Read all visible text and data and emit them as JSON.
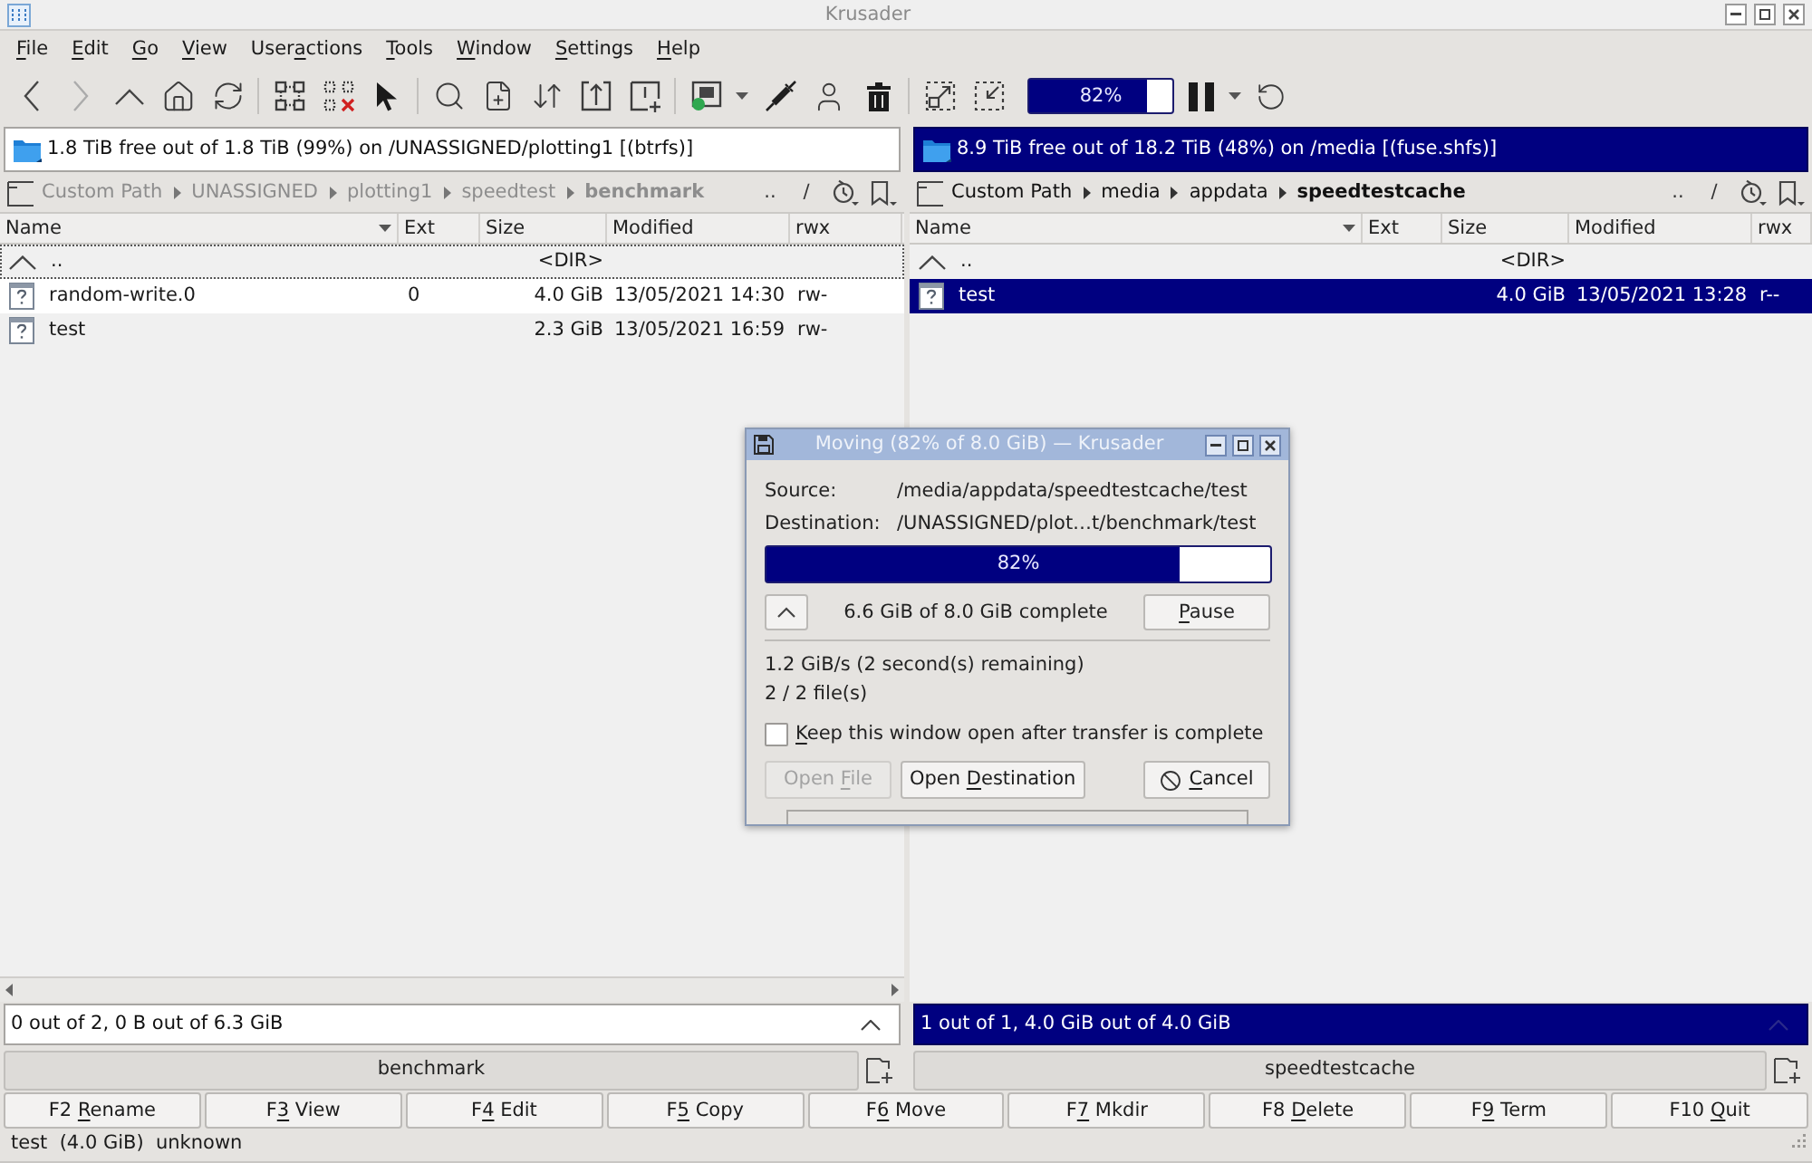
{
  "window": {
    "title": "Krusader"
  },
  "menu": [
    {
      "key": "F",
      "post": "ile"
    },
    {
      "key": "E",
      "post": "dit"
    },
    {
      "key": "G",
      "post": "o"
    },
    {
      "key": "V",
      "post": "iew"
    },
    {
      "pre": "User",
      "key": "a",
      "post": "ctions"
    },
    {
      "key": "T",
      "post": "ools"
    },
    {
      "key": "W",
      "post": "indow"
    },
    {
      "key": "S",
      "post": "ettings"
    },
    {
      "key": "H",
      "post": "elp"
    }
  ],
  "toolbar": {
    "back": {
      "disabled": false
    },
    "forward": {
      "disabled": true
    },
    "progress": {
      "level": 0.82,
      "text": "82%"
    }
  },
  "panels": [
    {
      "active": false,
      "disk_info": "1.8 TiB free out of 1.8 TiB (99%) on /UNASSIGNED/plotting1 [(btrfs)]",
      "path": [
        "Custom Path",
        "UNASSIGNED",
        "plotting1",
        "speedtest",
        "benchmark"
      ],
      "path_buttons": [
        "..",
        "/"
      ],
      "columns": [
        {
          "label": "Name",
          "sorted": true
        },
        {
          "label": "Ext",
          "sorted": false
        },
        {
          "label": "Size",
          "sorted": false
        },
        {
          "label": "Modified",
          "sorted": false
        },
        {
          "label": "rwx",
          "sorted": false
        }
      ],
      "rows": [
        {
          "kind": "parent",
          "name": "..",
          "size": "<DIR>",
          "selected": false,
          "current": true
        },
        {
          "kind": "file",
          "name": "random-write.0",
          "ext": "0",
          "size": "4.0 GiB",
          "modified": "13/05/2021 14:30",
          "rwx": "rw-",
          "selected": false,
          "current": false
        },
        {
          "kind": "file",
          "name": "test",
          "size": "2.3 GiB",
          "modified": "13/05/2021 16:59",
          "rwx": "rw-",
          "selected": false,
          "current": false
        }
      ],
      "scrollbar": true,
      "status": "0 out of 2, 0 B out of 6.3 GiB",
      "tab": "benchmark"
    },
    {
      "active": true,
      "disk_info": "8.9 TiB free out of 18.2 TiB (48%) on /media [(fuse.shfs)]",
      "path": [
        "Custom Path",
        "media",
        "appdata",
        "speedtestcache"
      ],
      "path_buttons": [
        "..",
        "/"
      ],
      "columns": [
        {
          "label": "Name",
          "sorted": true
        },
        {
          "label": "Ext",
          "sorted": false
        },
        {
          "label": "Size",
          "sorted": false
        },
        {
          "label": "Modified",
          "sorted": false
        },
        {
          "label": "rwx",
          "sorted": false
        }
      ],
      "rows": [
        {
          "kind": "parent",
          "name": "..",
          "size": "<DIR>",
          "selected": false,
          "current": false
        },
        {
          "kind": "file",
          "name": "test",
          "size": "4.0 GiB",
          "modified": "13/05/2021 13:28",
          "rwx": "r--",
          "selected": true,
          "current": false
        }
      ],
      "scrollbar": false,
      "status": "1 out of 1, 4.0 GiB out of 4.0 GiB",
      "tab": "speedtestcache"
    }
  ],
  "function_keys": [
    {
      "pre": "F2 ",
      "key": "R",
      "post": "ename"
    },
    {
      "pre": "F",
      "key": "3",
      "post": " View"
    },
    {
      "pre": "F",
      "key": "4",
      "post": " Edit"
    },
    {
      "pre": "F",
      "key": "5",
      "post": " Copy"
    },
    {
      "pre": "F",
      "key": "6",
      "post": " Move"
    },
    {
      "pre": "F",
      "key": "7",
      "post": " Mkdir"
    },
    {
      "pre": "F8 ",
      "key": "D",
      "post": "elete"
    },
    {
      "pre": "F",
      "key": "9",
      "post": " Term"
    },
    {
      "pre": "F10 ",
      "key": "Q",
      "post": "uit"
    }
  ],
  "status_line": "test  (4.0 GiB)  unknown",
  "dialog": {
    "title": "Moving (82% of 8.0 GiB) — Krusader",
    "fields": [
      {
        "label": "Source:",
        "value": "/media/appdata/speedtestcache/test"
      },
      {
        "label": "Destination:",
        "value": "/UNASSIGNED/plot…t/benchmark/test"
      }
    ],
    "progress": {
      "level": 0.82,
      "text": "82%"
    },
    "progress_text": "6.6 GiB of 8.0 GiB complete",
    "pause": {
      "key": "P",
      "post": "ause"
    },
    "speed": "1.2 GiB/s (2 second(s) remaining)",
    "files": "2 / 2 file(s)",
    "keep_open": {
      "checked": false,
      "key": "K",
      "post": "eep this window open after transfer is complete"
    },
    "buttons": [
      {
        "kind": "open",
        "pre": "Open ",
        "key": "F",
        "post": "ile",
        "disabled": true
      },
      {
        "kind": "open",
        "pre": "Open ",
        "key": "D",
        "post": "estination",
        "disabled": false
      },
      {
        "kind": "cancel",
        "key": "C",
        "post": "ancel",
        "disabled": false
      }
    ]
  }
}
